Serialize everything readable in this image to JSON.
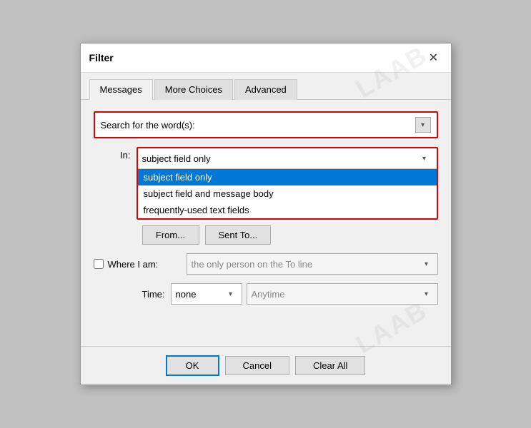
{
  "dialog": {
    "title": "Filter",
    "close_label": "✕"
  },
  "tabs": [
    {
      "id": "messages",
      "label": "Messages",
      "active": true
    },
    {
      "id": "more-choices",
      "label": "More Choices",
      "active": false
    },
    {
      "id": "advanced",
      "label": "Advanced",
      "active": false
    }
  ],
  "search": {
    "label": "Search for the word(s):",
    "value": "",
    "placeholder": ""
  },
  "in_field": {
    "label": "In:",
    "selected": "subject field only",
    "options": [
      {
        "id": "subject-only",
        "label": "subject field only",
        "selected": true
      },
      {
        "id": "subject-body",
        "label": "subject field and message body",
        "selected": false
      },
      {
        "id": "frequently-used",
        "label": "frequently-used text fields",
        "selected": false
      }
    ]
  },
  "buttons": {
    "from": "From...",
    "sent_to": "Sent To..."
  },
  "where_i_am": {
    "label": "Where I am:",
    "checked": false,
    "placeholder": "the only person on the To line"
  },
  "time": {
    "label": "Time:",
    "value": "none",
    "anytime_placeholder": "Anytime"
  },
  "footer": {
    "ok": "OK",
    "cancel": "Cancel",
    "clear_all": "Clear All"
  },
  "watermark": "LAAB"
}
